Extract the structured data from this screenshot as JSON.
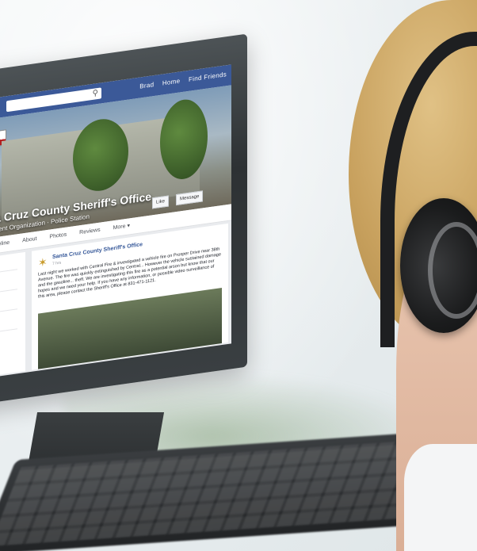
{
  "facebook_page": {
    "search_icon": "magnifier",
    "nav_links": [
      "Brad",
      "Home",
      "Find Friends"
    ],
    "page_title": "nta Cruz County Sheriff's Office",
    "page_subtitle": "ernment Organization · Police Station",
    "like_button": "Like",
    "message_button": "Message",
    "tabs": [
      "Timeline",
      "About",
      "Photos",
      "Reviews",
      "More ▾"
    ],
    "post": {
      "author": "Santa Cruz County Sheriff's Office",
      "time": "7 hrs",
      "text": "Last night we worked with Central Fire & investigated a vehicle fire on Prosper Drive near 38th Avenue. The fire was quickly extinguished by Central... However the vehicle sustained damage and the gasoline... theft. We are investigating this fire as a potential arson but know that our hopes and we need your help. If you have any information, or possible video surveillance of this area, please contact the Sheriff's Office at 831-471-1121."
    }
  },
  "colors": {
    "facebook_blue": "#3b5998",
    "background": "#eef2f3",
    "headset": "#1e1f21",
    "hair": "#c8a15e"
  }
}
